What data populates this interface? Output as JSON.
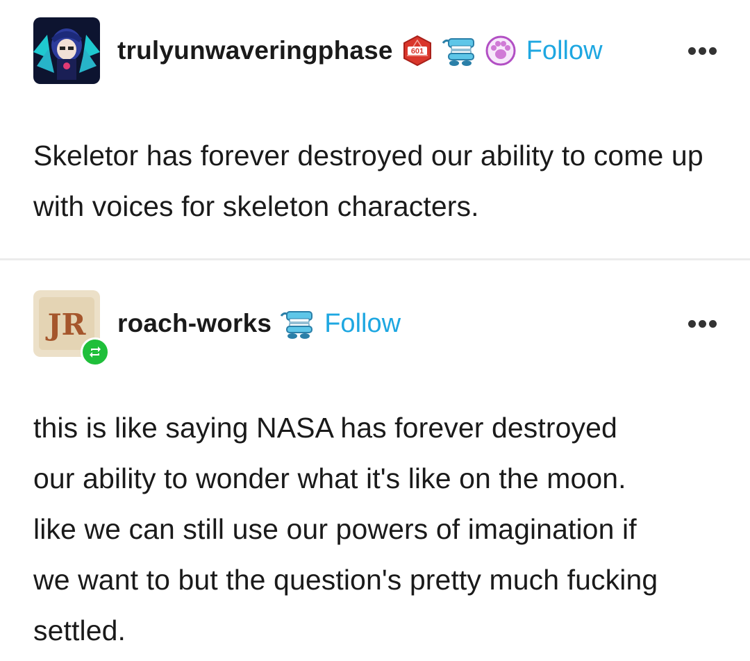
{
  "posts": [
    {
      "username": "trulyunwaveringphase",
      "badges": [
        {
          "icon": "d20-badge-icon",
          "label": "601",
          "color": "#d9362b"
        },
        {
          "icon": "chattering-teeth-badge-icon"
        },
        {
          "icon": "paw-print-badge-icon",
          "color": "#d07ad6"
        }
      ],
      "follow_label": "Follow",
      "more_icon": "more-options-icon",
      "text": "Skeletor has forever destroyed our ability to come up with voices for skeleton characters."
    },
    {
      "username": "roach-works",
      "badges": [
        {
          "icon": "chattering-teeth-badge-icon"
        }
      ],
      "follow_label": "Follow",
      "more_icon": "more-options-icon",
      "reblog_icon": "reblog-icon",
      "avatar_text": "JR",
      "text": "this is like saying NASA has forever destroyed our ability to wonder what it's like on the moon. like we can still use our powers of imagination if we want to but the question's pretty much fucking settled."
    }
  ],
  "colors": {
    "follow": "#1ea7e1",
    "reblog": "#1fbf3a",
    "divider": "#ececec"
  }
}
